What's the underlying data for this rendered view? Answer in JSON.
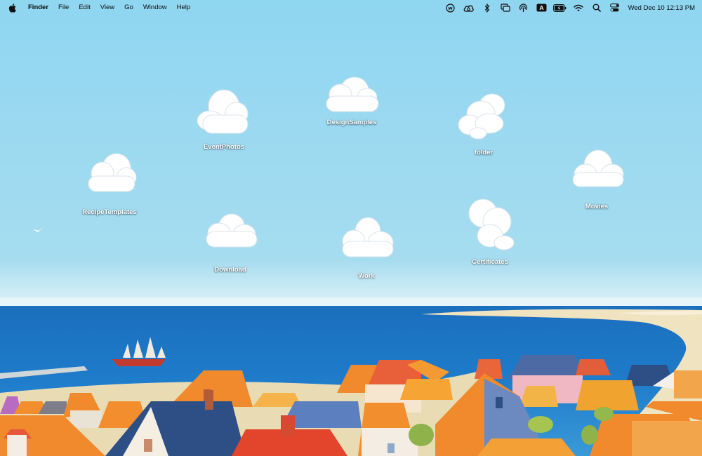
{
  "menubar": {
    "apple_icon": "apple-logo-icon",
    "app_name": "Finder",
    "menus": [
      "File",
      "Edit",
      "View",
      "Go",
      "Window",
      "Help"
    ],
    "status_icons": [
      "weather-widget-icon",
      "creative-cloud-icon",
      "bluetooth-icon",
      "screen-mirroring-icon",
      "airdrop-icon",
      "input-source-icon",
      "battery-charging-icon",
      "wifi-icon",
      "spotlight-search-icon",
      "control-center-icon"
    ],
    "input_source_letter": "A",
    "clock": "Wed Dec 10  12:13 PM"
  },
  "desktop": {
    "icons": [
      {
        "label": "EventPhotos",
        "icon": "folder-icon"
      },
      {
        "label": "DesignSamples",
        "icon": "folder-icon"
      },
      {
        "label": "folder",
        "icon": "folder-icon"
      },
      {
        "label": "RecipeTemplates",
        "icon": "folder-icon"
      },
      {
        "label": "Movies",
        "icon": "folder-icon"
      },
      {
        "label": "Download",
        "icon": "folder-icon"
      },
      {
        "label": "Work",
        "icon": "folder-icon"
      },
      {
        "label": "Certificates",
        "icon": "folder-icon"
      }
    ]
  },
  "colors": {
    "sky_top": "#8fd6f1",
    "sky_bottom": "#a9dcef",
    "sea": "#1a73c2",
    "sand": "#efe3c0",
    "roof_orange": "#f08a2c",
    "roof_red": "#e2452b",
    "roof_blue": "#2d4f86"
  }
}
